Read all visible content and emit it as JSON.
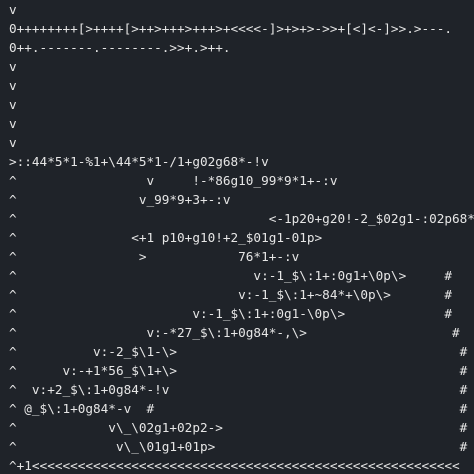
{
  "terminal": {
    "lines": [
      "v",
      "0++++++++[>++++[>++>+++>+++>+<<<<-]>+>+>->>+[<]<-]>>.>---.",
      "0++.-------.--------.>>+.>++.",
      "v",
      "v",
      "v",
      "v",
      "v",
      ">::44*5*1-%1+\\44*5*1-/1+g02g68*-!v",
      "^                 v     !-*86g10_99*9*1+-:v",
      "^                v_99*9+3+-:v",
      "^                                 <-1p20+g20!-2_$02g1-:02p68*-",
      "^               <+1 p10+g10!+2_$01g1-01p>",
      "^                >            76*1+-:v",
      "^                               v:-1_$\\:1+:0g1+\\0p\\>     #",
      "^                             v:-1_$\\:1+~84*+\\0p\\>       #",
      "^                       v:-1_$\\:1+:0g1-\\0p\\>             #",
      "^                 v:-*27_$\\:1+0g84*-,\\>                   #",
      "^          v:-2_$\\1-\\>                                     #",
      "^      v:-+1*56_$\\1+\\>                                     #",
      "^  v:+2_$\\:1+0g84*-!v                                      #",
      "^ @_$\\:1+0g84*-v  #                                        #",
      "^            v\\_\\02g1+02p2->                               #",
      "^             v\\_\\01g1+01p>                                #",
      "^+1<<<<<<<<<<<<<<<<<<<<<<<<<<<<<<<<<<<<<<<<<<<<<<<<<<<<<<<<"
    ]
  }
}
